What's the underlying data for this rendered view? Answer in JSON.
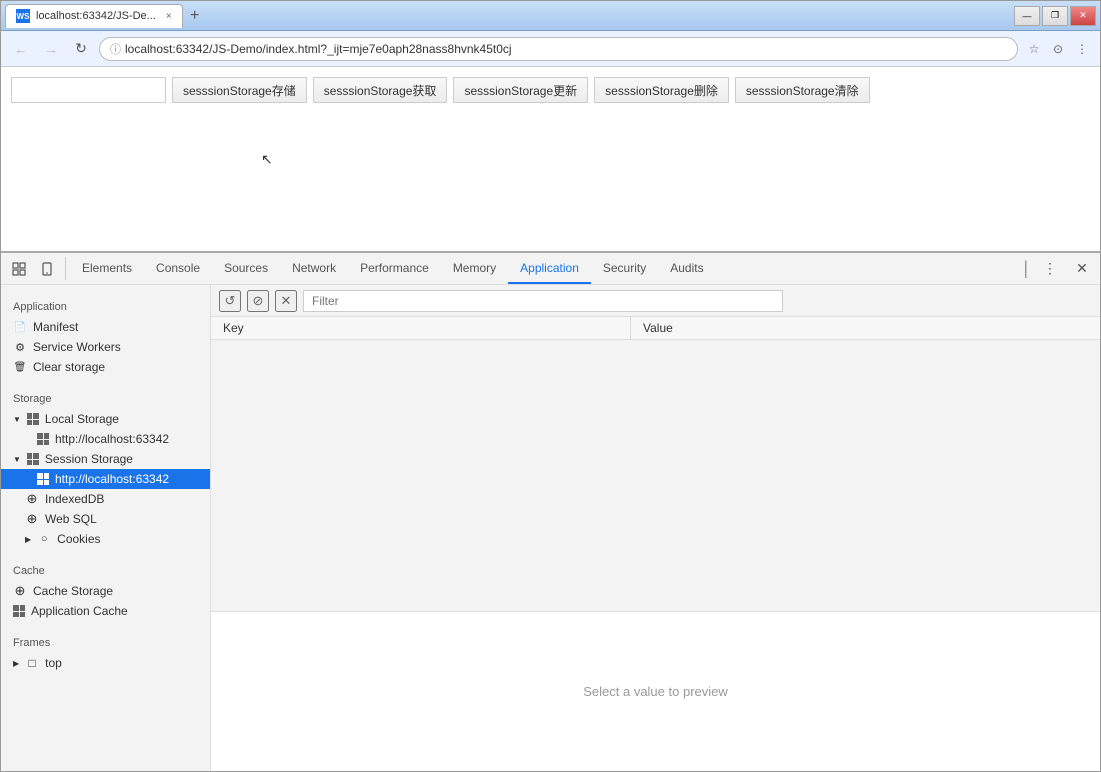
{
  "window": {
    "title": "localhost:63342/JS-De...",
    "favicon": "WS",
    "tab_close": "×",
    "tab_new": "+",
    "controls": {
      "minimize": "—",
      "restore": "❐",
      "close": "✕"
    }
  },
  "address_bar": {
    "back": "←",
    "forward": "→",
    "refresh": "↻",
    "url": "localhost:63342/JS-Demo/index.html?_ijt=mje7e0aph28nass8hvnk45t0cj",
    "bookmark": "☆",
    "person": "⊙",
    "menu": "⋮"
  },
  "page": {
    "text_input_placeholder": "",
    "buttons": [
      "sesssionStorage存储",
      "sesssionStorage获取",
      "sesssionStorage更新",
      "sesssionStorage删除",
      "sesssionStorage清除"
    ]
  },
  "devtools": {
    "toolbar_icons": [
      "devtools-left-icon",
      "devtools-right-icon"
    ],
    "tabs": [
      {
        "id": "elements",
        "label": "Elements"
      },
      {
        "id": "console",
        "label": "Console"
      },
      {
        "id": "sources",
        "label": "Sources"
      },
      {
        "id": "network",
        "label": "Network"
      },
      {
        "id": "performance",
        "label": "Performance"
      },
      {
        "id": "memory",
        "label": "Memory"
      },
      {
        "id": "application",
        "label": "Application",
        "active": true
      },
      {
        "id": "security",
        "label": "Security"
      },
      {
        "id": "audits",
        "label": "Audits"
      }
    ],
    "menu_dots": "⋮",
    "close": "✕"
  },
  "sidebar": {
    "application_section": "Application",
    "storage_section": "Storage",
    "cache_section": "Cache",
    "frames_section": "Frames",
    "app_items": [
      {
        "id": "manifest",
        "label": "Manifest",
        "icon": "file"
      },
      {
        "id": "service-workers",
        "label": "Service Workers",
        "icon": "gear"
      },
      {
        "id": "clear-storage",
        "label": "Clear storage",
        "icon": "trash"
      }
    ],
    "local_storage_label": "Local Storage",
    "local_storage_url": "http://localhost:63342",
    "session_storage_label": "Session Storage",
    "session_storage_url": "http://localhost:63342",
    "indexed_db": "IndexedDB",
    "web_sql": "Web SQL",
    "cookies": "Cookies",
    "cache_storage": "Cache Storage",
    "application_cache": "Application Cache",
    "frames_top": "top"
  },
  "filter": {
    "placeholder": "Filter",
    "refresh_icon": "↺",
    "block_icon": "⊘",
    "clear_icon": "✕"
  },
  "table": {
    "col_key": "Key",
    "col_value": "Value",
    "rows": []
  },
  "preview": {
    "text": "Select a value to preview"
  }
}
